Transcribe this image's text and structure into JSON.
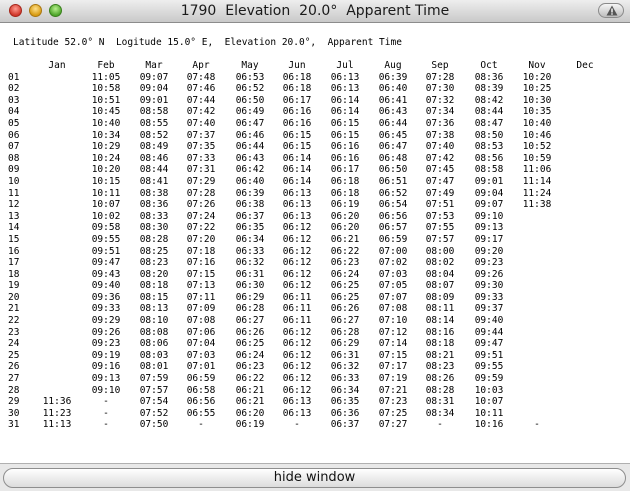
{
  "window": {
    "title": "1790  Elevation  20.0°  Apparent Time"
  },
  "header_line": "Latitude 52.0° N  Logitude 15.0° E,  Elevation 20.0°,  Apparent Time",
  "months": [
    "Jan",
    "Feb",
    "Mar",
    "Apr",
    "May",
    "Jun",
    "Jul",
    "Aug",
    "Sep",
    "Oct",
    "Nov",
    "Dec"
  ],
  "rows": [
    {
      "day": "01",
      "cells": [
        "",
        "11:05",
        "09:07",
        "07:48",
        "06:53",
        "06:18",
        "06:13",
        "06:39",
        "07:28",
        "08:36",
        "10:20",
        ""
      ]
    },
    {
      "day": "02",
      "cells": [
        "",
        "10:58",
        "09:04",
        "07:46",
        "06:52",
        "06:18",
        "06:13",
        "06:40",
        "07:30",
        "08:39",
        "10:25",
        ""
      ]
    },
    {
      "day": "03",
      "cells": [
        "",
        "10:51",
        "09:01",
        "07:44",
        "06:50",
        "06:17",
        "06:14",
        "06:41",
        "07:32",
        "08:42",
        "10:30",
        ""
      ]
    },
    {
      "day": "04",
      "cells": [
        "",
        "10:45",
        "08:58",
        "07:42",
        "06:49",
        "06:16",
        "06:14",
        "06:43",
        "07:34",
        "08:44",
        "10:35",
        ""
      ]
    },
    {
      "day": "05",
      "cells": [
        "",
        "10:40",
        "08:55",
        "07:40",
        "06:47",
        "06:16",
        "06:15",
        "06:44",
        "07:36",
        "08:47",
        "10:40",
        ""
      ]
    },
    {
      "day": "06",
      "cells": [
        "",
        "10:34",
        "08:52",
        "07:37",
        "06:46",
        "06:15",
        "06:15",
        "06:45",
        "07:38",
        "08:50",
        "10:46",
        ""
      ]
    },
    {
      "day": "07",
      "cells": [
        "",
        "10:29",
        "08:49",
        "07:35",
        "06:44",
        "06:15",
        "06:16",
        "06:47",
        "07:40",
        "08:53",
        "10:52",
        ""
      ]
    },
    {
      "day": "08",
      "cells": [
        "",
        "10:24",
        "08:46",
        "07:33",
        "06:43",
        "06:14",
        "06:16",
        "06:48",
        "07:42",
        "08:56",
        "10:59",
        ""
      ]
    },
    {
      "day": "09",
      "cells": [
        "",
        "10:20",
        "08:44",
        "07:31",
        "06:42",
        "06:14",
        "06:17",
        "06:50",
        "07:45",
        "08:58",
        "11:06",
        ""
      ]
    },
    {
      "day": "10",
      "cells": [
        "",
        "10:15",
        "08:41",
        "07:29",
        "06:40",
        "06:14",
        "06:18",
        "06:51",
        "07:47",
        "09:01",
        "11:14",
        ""
      ]
    },
    {
      "day": "11",
      "cells": [
        "",
        "10:11",
        "08:38",
        "07:28",
        "06:39",
        "06:13",
        "06:18",
        "06:52",
        "07:49",
        "09:04",
        "11:24",
        ""
      ]
    },
    {
      "day": "12",
      "cells": [
        "",
        "10:07",
        "08:36",
        "07:26",
        "06:38",
        "06:13",
        "06:19",
        "06:54",
        "07:51",
        "09:07",
        "11:38",
        ""
      ]
    },
    {
      "day": "13",
      "cells": [
        "",
        "10:02",
        "08:33",
        "07:24",
        "06:37",
        "06:13",
        "06:20",
        "06:56",
        "07:53",
        "09:10",
        "",
        ""
      ]
    },
    {
      "day": "14",
      "cells": [
        "",
        "09:58",
        "08:30",
        "07:22",
        "06:35",
        "06:12",
        "06:20",
        "06:57",
        "07:55",
        "09:13",
        "",
        ""
      ]
    },
    {
      "day": "15",
      "cells": [
        "",
        "09:55",
        "08:28",
        "07:20",
        "06:34",
        "06:12",
        "06:21",
        "06:59",
        "07:57",
        "09:17",
        "",
        ""
      ]
    },
    {
      "day": "16",
      "cells": [
        "",
        "09:51",
        "08:25",
        "07:18",
        "06:33",
        "06:12",
        "06:22",
        "07:00",
        "08:00",
        "09:20",
        "",
        ""
      ]
    },
    {
      "day": "17",
      "cells": [
        "",
        "09:47",
        "08:23",
        "07:16",
        "06:32",
        "06:12",
        "06:23",
        "07:02",
        "08:02",
        "09:23",
        "",
        ""
      ]
    },
    {
      "day": "18",
      "cells": [
        "",
        "09:43",
        "08:20",
        "07:15",
        "06:31",
        "06:12",
        "06:24",
        "07:03",
        "08:04",
        "09:26",
        "",
        ""
      ]
    },
    {
      "day": "19",
      "cells": [
        "",
        "09:40",
        "08:18",
        "07:13",
        "06:30",
        "06:12",
        "06:25",
        "07:05",
        "08:07",
        "09:30",
        "",
        ""
      ]
    },
    {
      "day": "20",
      "cells": [
        "",
        "09:36",
        "08:15",
        "07:11",
        "06:29",
        "06:11",
        "06:25",
        "07:07",
        "08:09",
        "09:33",
        "",
        ""
      ]
    },
    {
      "day": "21",
      "cells": [
        "",
        "09:33",
        "08:13",
        "07:09",
        "06:28",
        "06:11",
        "06:26",
        "07:08",
        "08:11",
        "09:37",
        "",
        ""
      ]
    },
    {
      "day": "22",
      "cells": [
        "",
        "09:29",
        "08:10",
        "07:08",
        "06:27",
        "06:11",
        "06:27",
        "07:10",
        "08:14",
        "09:40",
        "",
        ""
      ]
    },
    {
      "day": "23",
      "cells": [
        "",
        "09:26",
        "08:08",
        "07:06",
        "06:26",
        "06:12",
        "06:28",
        "07:12",
        "08:16",
        "09:44",
        "",
        ""
      ]
    },
    {
      "day": "24",
      "cells": [
        "",
        "09:23",
        "08:06",
        "07:04",
        "06:25",
        "06:12",
        "06:29",
        "07:14",
        "08:18",
        "09:47",
        "",
        ""
      ]
    },
    {
      "day": "25",
      "cells": [
        "",
        "09:19",
        "08:03",
        "07:03",
        "06:24",
        "06:12",
        "06:31",
        "07:15",
        "08:21",
        "09:51",
        "",
        ""
      ]
    },
    {
      "day": "26",
      "cells": [
        "",
        "09:16",
        "08:01",
        "07:01",
        "06:23",
        "06:12",
        "06:32",
        "07:17",
        "08:23",
        "09:55",
        "",
        ""
      ]
    },
    {
      "day": "27",
      "cells": [
        "",
        "09:13",
        "07:59",
        "06:59",
        "06:22",
        "06:12",
        "06:33",
        "07:19",
        "08:26",
        "09:59",
        "",
        ""
      ]
    },
    {
      "day": "28",
      "cells": [
        "",
        "09:10",
        "07:57",
        "06:58",
        "06:21",
        "06:12",
        "06:34",
        "07:21",
        "08:28",
        "10:03",
        "",
        ""
      ]
    },
    {
      "day": "29",
      "cells": [
        "11:36",
        "-",
        "07:54",
        "06:56",
        "06:21",
        "06:13",
        "06:35",
        "07:23",
        "08:31",
        "10:07",
        "",
        ""
      ]
    },
    {
      "day": "30",
      "cells": [
        "11:23",
        "-",
        "07:52",
        "06:55",
        "06:20",
        "06:13",
        "06:36",
        "07:25",
        "08:34",
        "10:11",
        "",
        ""
      ]
    },
    {
      "day": "31",
      "cells": [
        "11:13",
        "-",
        "07:50",
        "-",
        "06:19",
        "-",
        "06:37",
        "07:27",
        "-",
        "10:16",
        "-",
        ""
      ]
    }
  ],
  "buttons": {
    "hide_label": "hide window"
  }
}
